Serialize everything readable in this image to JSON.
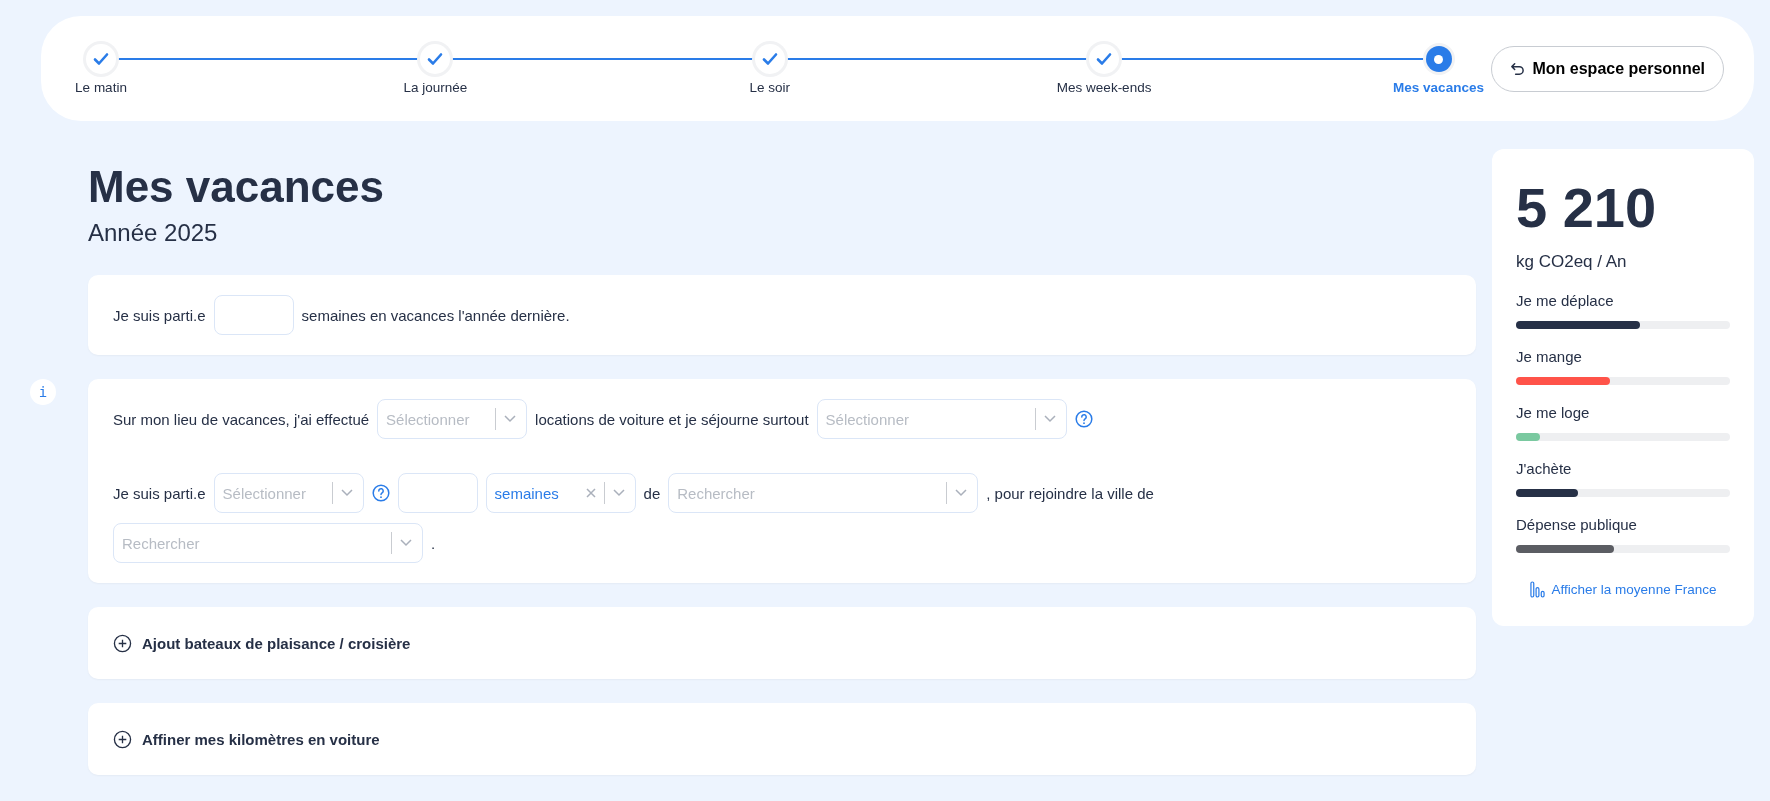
{
  "stepper": {
    "steps": [
      {
        "label": "Le matin",
        "completed": true,
        "selected": false
      },
      {
        "label": "La journée",
        "completed": true,
        "selected": false
      },
      {
        "label": "Le soir",
        "completed": true,
        "selected": false
      },
      {
        "label": "Mes week-ends",
        "completed": true,
        "selected": false
      },
      {
        "label": "Mes vacances",
        "completed": false,
        "selected": true
      }
    ],
    "button": "Mon espace personnel"
  },
  "page": {
    "title": "Mes vacances",
    "subtitle": "Année 2025"
  },
  "questions": [
    {
      "paragraphs": [
        [
          {
            "kind": "text",
            "text": "Je suis parti.e"
          },
          {
            "kind": "input"
          },
          {
            "kind": "text",
            "text": "semaines en vacances l'année dernière."
          }
        ]
      ]
    },
    {
      "info": "i",
      "paragraphs": [
        [
          {
            "kind": "text",
            "text": "Sur mon lieu de vacances, j'ai effectué"
          },
          {
            "kind": "select",
            "placeholder": "Sélectionner"
          },
          {
            "kind": "text",
            "text": "locations de voiture et  je séjourne surtout"
          },
          {
            "kind": "select-wide",
            "placeholder": "Sélectionner"
          },
          {
            "kind": "help"
          }
        ],
        [
          {
            "kind": "text",
            "text": "Je suis parti.e"
          },
          {
            "kind": "select",
            "placeholder": "Sélectionner"
          },
          {
            "kind": "help"
          },
          {
            "kind": "input"
          },
          {
            "kind": "select",
            "value": "semaines",
            "clearable": true
          },
          {
            "kind": "text",
            "text": "de"
          },
          {
            "kind": "search",
            "placeholder": "Rechercher"
          },
          {
            "kind": "text",
            "text": ", pour rejoindre la ville de"
          },
          {
            "kind": "search",
            "placeholder": "Rechercher"
          },
          {
            "kind": "text",
            "text": "."
          }
        ]
      ]
    }
  ],
  "sections": [
    {
      "title": "Ajout bateaux de plaisance / croisière",
      "expanded": false
    },
    {
      "title": "Affiner mes kilomètres en voiture",
      "expanded": false
    }
  ],
  "summary": {
    "total": "5 210",
    "unit": "kg CO2eq / An",
    "categories": [
      {
        "label": "Je me déplace",
        "level": 0.58,
        "color": "#263046"
      },
      {
        "label": "Je mange",
        "level": 0.44,
        "color": "#ff5349"
      },
      {
        "label": "Je me loge",
        "level": 0.11,
        "color": "#7ac9a0"
      },
      {
        "label": "J'achète",
        "level": 0.29,
        "color": "#263046"
      },
      {
        "label": "Dépense publique",
        "level": 0.46,
        "color": "#5b5d63"
      }
    ],
    "link": "Afficher la moyenne France"
  }
}
